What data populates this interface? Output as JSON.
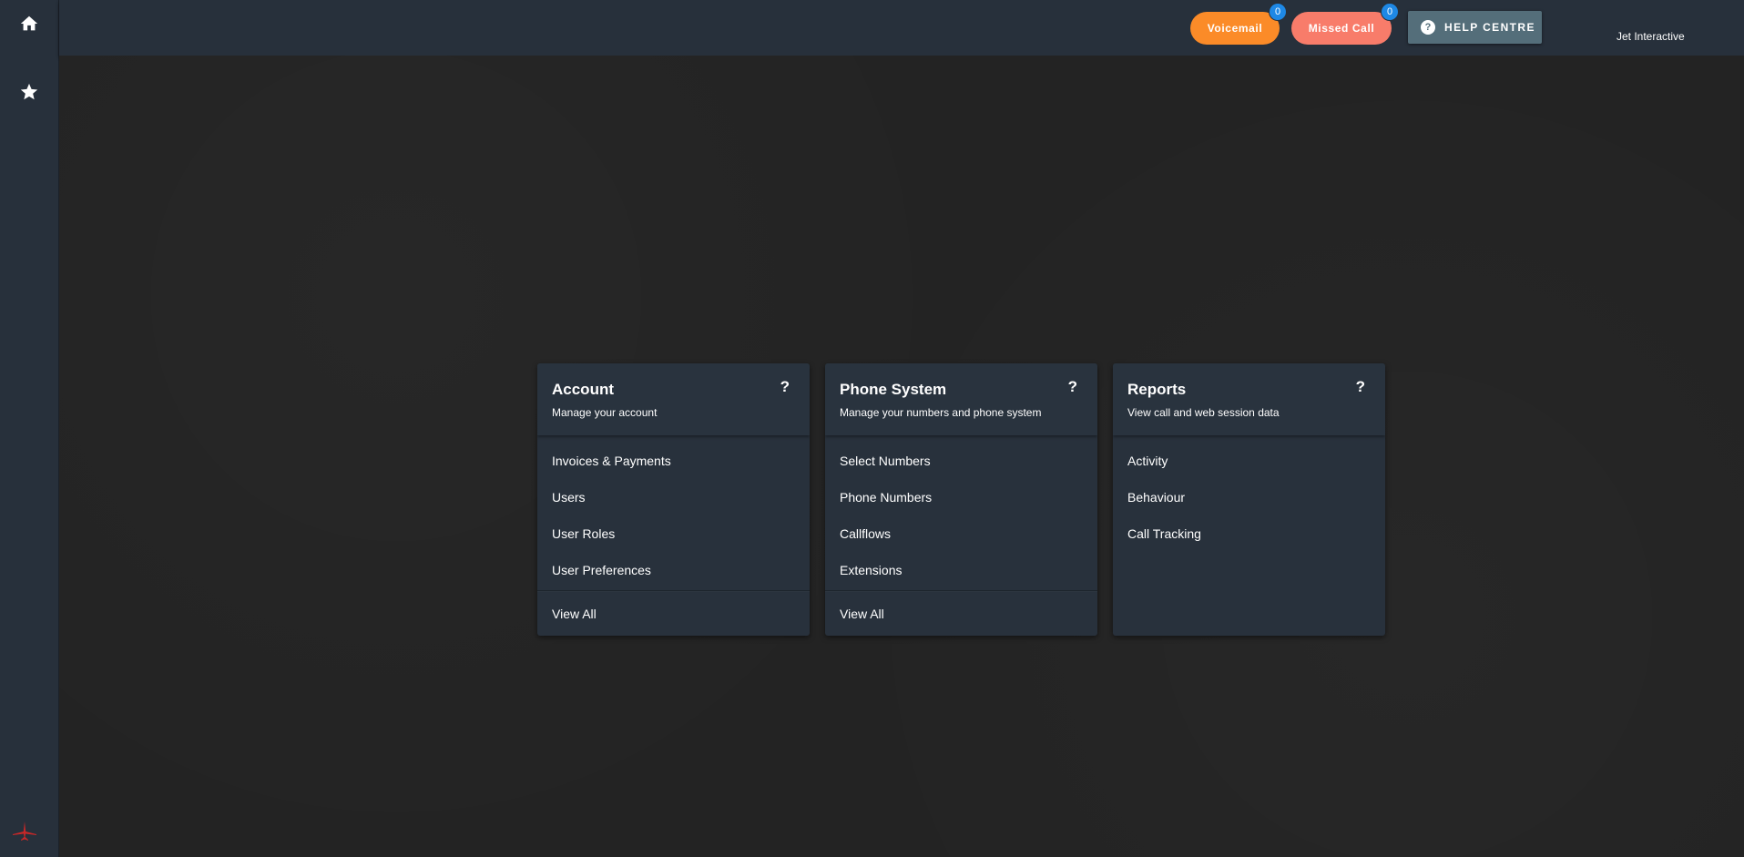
{
  "sidebar": {
    "items": [
      {
        "icon": "home-icon"
      },
      {
        "icon": "star-icon"
      }
    ],
    "logo_color": "#c62828"
  },
  "header": {
    "voicemail": {
      "label": "Voicemail",
      "count": "0"
    },
    "missed_call": {
      "label": "Missed Call",
      "count": "0"
    },
    "help": {
      "label": "HELP CENTRE"
    },
    "account_name": "Jet Interactive"
  },
  "colors": {
    "voicemail": "#fb8b28",
    "missed_call": "#f87c6a",
    "badge": "#1e88e5",
    "help_button": "#546e7a",
    "panel": "#28313c",
    "background": "#232323"
  },
  "cards": [
    {
      "title": "Account",
      "subtitle": "Manage your account",
      "help": "?",
      "items": [
        "Invoices & Payments",
        "Users",
        "User Roles",
        "User Preferences"
      ],
      "footer": "View All"
    },
    {
      "title": "Phone System",
      "subtitle": "Manage your numbers and phone system",
      "help": "?",
      "items": [
        "Select Numbers",
        "Phone Numbers",
        "Callflows",
        "Extensions"
      ],
      "footer": "View All"
    },
    {
      "title": "Reports",
      "subtitle": "View call and web session data",
      "help": "?",
      "items": [
        "Activity",
        "Behaviour",
        "Call Tracking"
      ]
    }
  ]
}
